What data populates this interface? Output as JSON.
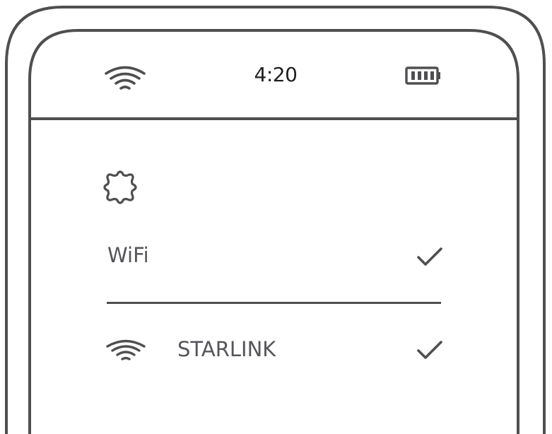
{
  "status_bar": {
    "time": "4:20",
    "signal_icon": "wifi-signal-icon",
    "battery_icon": "battery-icon"
  },
  "settings": {
    "icon": "gear-icon",
    "wifi_row": {
      "label": "WiFi",
      "state_icon": "checkmark-icon"
    },
    "networks": [
      {
        "name": "STARLINK",
        "signal_icon": "wifi-signal-icon",
        "state_icon": "checkmark-icon"
      }
    ]
  },
  "colors": {
    "stroke": "#4f4f52",
    "text": "#55555a",
    "time_text": "#1f1f22",
    "background": "#ffffff"
  }
}
